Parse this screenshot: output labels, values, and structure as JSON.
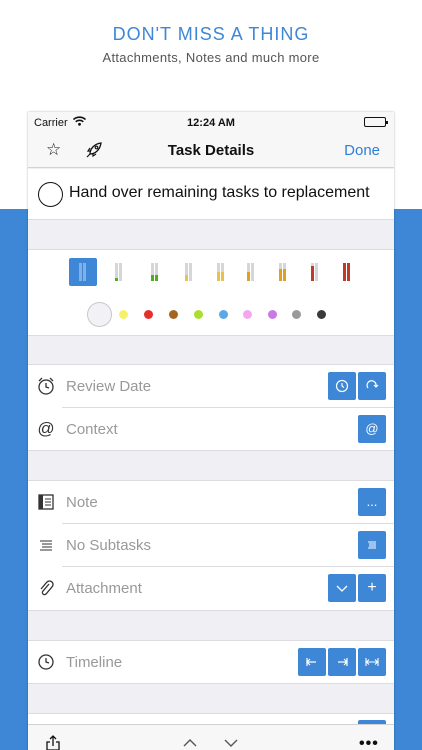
{
  "promo": {
    "title": "DON'T MISS A THING",
    "subtitle": "Attachments, Notes and much more"
  },
  "status_bar": {
    "carrier": "Carrier",
    "time": "12:24 AM"
  },
  "nav": {
    "title": "Task Details",
    "done_label": "Done",
    "star_icon": "star-icon",
    "rocket_icon": "rocket-icon"
  },
  "task": {
    "title": "Hand over remaining tasks to replacement"
  },
  "priorities": [
    {
      "name": "none",
      "color": "#3d87d6"
    },
    {
      "name": "low-1",
      "color": "#4caf1f"
    },
    {
      "name": "low-2",
      "color": "#4caf1f"
    },
    {
      "name": "medium-1",
      "color": "#e8c24a"
    },
    {
      "name": "medium-2",
      "color": "#e8c24a"
    },
    {
      "name": "high-1",
      "color": "#e0a020"
    },
    {
      "name": "high-2",
      "color": "#e0a020"
    },
    {
      "name": "urgent-1",
      "color": "#c0392b"
    },
    {
      "name": "urgent-2",
      "color": "#c0392b"
    }
  ],
  "colors": [
    "#f5f267",
    "#e82d2d",
    "#a5651f",
    "#a8e02c",
    "#5aa7ea",
    "#f3a8ee",
    "#c77ae6",
    "#9a9a9a",
    "#3a3a3a"
  ],
  "rows": {
    "review_date": {
      "label": "Review Date"
    },
    "context": {
      "label": "Context",
      "button": "@"
    },
    "note": {
      "label": "Note",
      "button": "..."
    },
    "subtasks": {
      "label": "No Subtasks"
    },
    "attachment": {
      "label": "Attachment",
      "add_button": "+"
    },
    "timeline": {
      "label": "Timeline"
    }
  },
  "accent_color": "#3d87d6"
}
